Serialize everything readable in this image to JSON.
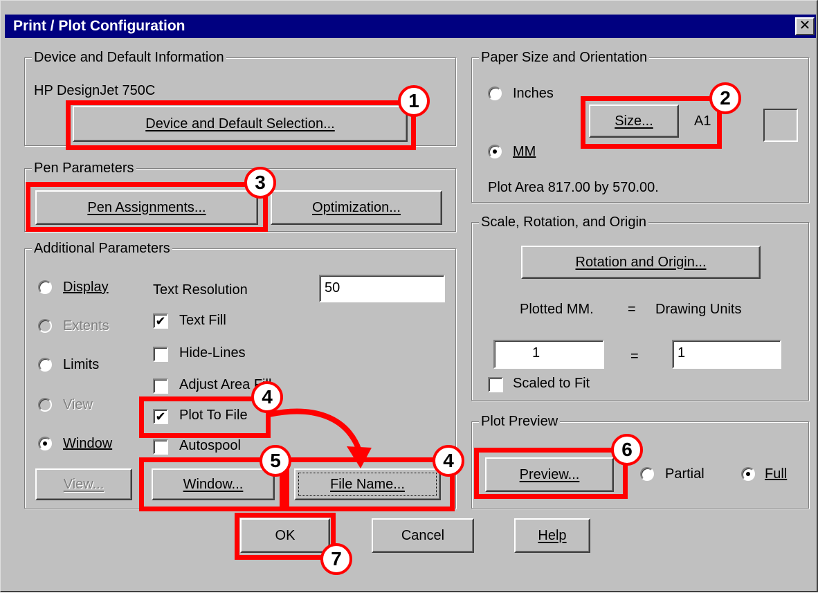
{
  "window": {
    "title": "Print / Plot Configuration",
    "close_label": "✕"
  },
  "device": {
    "group_label": "Device and Default Information",
    "device_name": "HP DesignJet 750C",
    "select_button": "Device and Default Selection..."
  },
  "pen": {
    "group_label": "Pen Parameters",
    "assignments_button": "Pen Assignments...",
    "optimization_button": "Optimization..."
  },
  "additional": {
    "group_label": "Additional Parameters",
    "area_options": [
      {
        "label": "Display",
        "selected": false,
        "enabled": true
      },
      {
        "label": "Extents",
        "selected": false,
        "enabled": false
      },
      {
        "label": "Limits",
        "selected": false,
        "enabled": true
      },
      {
        "label": "View",
        "selected": false,
        "enabled": false
      },
      {
        "label": "Window",
        "selected": true,
        "enabled": true
      }
    ],
    "text_resolution_label": "Text Resolution",
    "text_resolution_value": "50",
    "checkboxes": [
      {
        "label": "Text Fill",
        "checked": true
      },
      {
        "label": "Hide-Lines",
        "checked": false
      },
      {
        "label": "Adjust Area Fill",
        "checked": false
      },
      {
        "label": "Plot To File",
        "checked": true
      },
      {
        "label": "Autospool",
        "checked": false
      }
    ],
    "view_button": "View...",
    "window_button": "Window...",
    "file_name_button": "File Name..."
  },
  "paper": {
    "group_label": "Paper Size and Orientation",
    "inches_label": "Inches",
    "mm_label": "MM",
    "units_selected": "MM",
    "size_button": "Size...",
    "size_value": "A1",
    "plot_area": "Plot Area 817.00 by 570.00."
  },
  "scale": {
    "group_label": "Scale, Rotation, and Origin",
    "rotation_button": "Rotation and Origin...",
    "plotted_label": "Plotted MM.",
    "equals": "=",
    "drawing_units_label": "Drawing Units",
    "plotted_value": "1",
    "drawing_value": "1",
    "scaled_to_fit_label": "Scaled to Fit",
    "scaled_to_fit_checked": false
  },
  "preview": {
    "group_label": "Plot Preview",
    "preview_button": "Preview...",
    "partial_label": "Partial",
    "full_label": "Full",
    "mode_selected": "Full"
  },
  "footer": {
    "ok_button": "OK",
    "cancel_button": "Cancel",
    "help_button": "Help"
  },
  "annotations": {
    "step_1": "1",
    "step_2": "2",
    "step_3": "3",
    "step_4a": "4",
    "step_4b": "4",
    "step_5": "5",
    "step_6": "6",
    "step_7": "7",
    "highlight_color": "#ff0000"
  }
}
